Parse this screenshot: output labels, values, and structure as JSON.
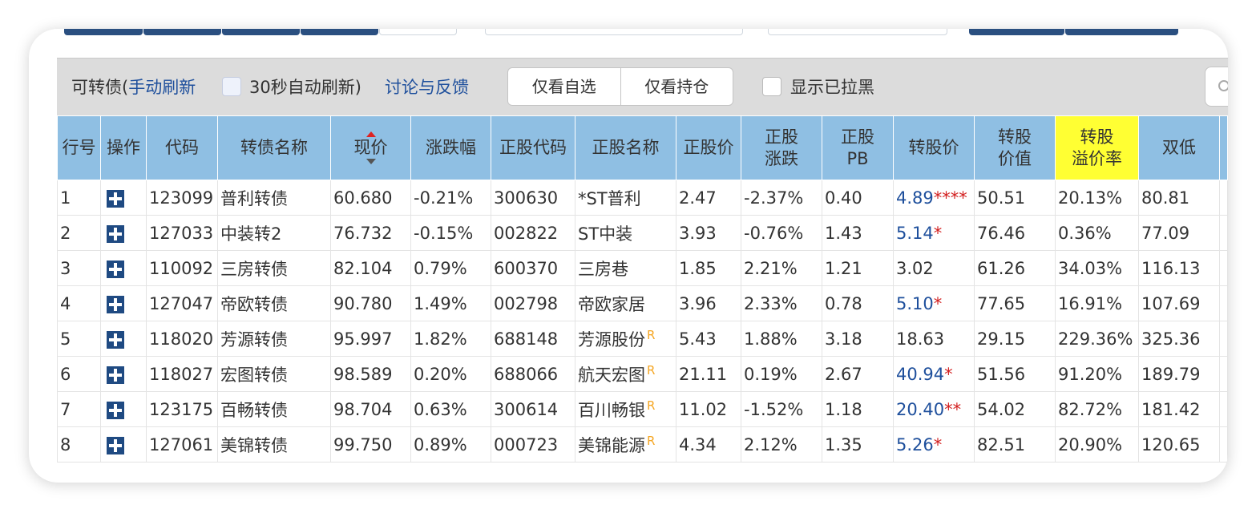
{
  "toolbar": {
    "title_prefix": "可转债(",
    "manual_refresh": "手动刷新",
    "auto_refresh_label": "30秒自动刷新)",
    "feedback": "讨论与反馈",
    "btn_watchlist": "仅看自选",
    "btn_holdings": "仅看持仓",
    "show_blacklist": "显示已拉黑"
  },
  "colors": {
    "header_bg": "#8fbfe3",
    "highlight_header": "#ffff33",
    "link": "#1e4f9c",
    "rise": "#cc2020",
    "fall": "#2a8a1f",
    "r_mark": "#f5a623",
    "star": "#d21e1e",
    "tab_strip": "#2a4f80"
  },
  "columns": {
    "c0": "行号",
    "c1": "操作",
    "c2": "代码",
    "c3": "转债名称",
    "c4": "现价",
    "c5": "涨跌幅",
    "c6": "正股代码",
    "c7": "正股名称",
    "c8": "正股价",
    "c9a": "正股",
    "c9b": "涨跌",
    "c10a": "正股",
    "c10b": "PB",
    "c11": "转股价",
    "c12a": "转股",
    "c12b": "价值",
    "c13a": "转股",
    "c13b": "溢价率",
    "c14": "双低"
  },
  "rows": [
    {
      "no": "1",
      "code": "123099",
      "name": "普利转债",
      "price": "60.680",
      "chg": "-0.21%",
      "scode": "300630",
      "sname": "*ST普利",
      "r": "",
      "sprice": "2.47",
      "schg": "-2.37%",
      "pb": "0.40",
      "cprice": "4.89",
      "stars": "****",
      "cvalue": "50.51",
      "premium": "20.13%",
      "dlow": "80.81"
    },
    {
      "no": "2",
      "code": "127033",
      "name": "中装转2",
      "price": "76.732",
      "chg": "-0.15%",
      "scode": "002822",
      "sname": "ST中装",
      "r": "",
      "sprice": "3.93",
      "schg": "-0.76%",
      "pb": "1.43",
      "cprice": "5.14",
      "stars": "*",
      "cvalue": "76.46",
      "premium": "0.36%",
      "dlow": "77.09"
    },
    {
      "no": "3",
      "code": "110092",
      "name": "三房转债",
      "price": "82.104",
      "chg": "0.79%",
      "scode": "600370",
      "sname": "三房巷",
      "r": "",
      "sprice": "1.85",
      "schg": "2.21%",
      "pb": "1.21",
      "cprice": "3.02",
      "stars": "",
      "cvalue": "61.26",
      "premium": "34.03%",
      "dlow": "116.13"
    },
    {
      "no": "4",
      "code": "127047",
      "name": "帝欧转债",
      "price": "90.780",
      "chg": "1.49%",
      "scode": "002798",
      "sname": "帝欧家居",
      "r": "",
      "sprice": "3.96",
      "schg": "2.33%",
      "pb": "0.78",
      "cprice": "5.10",
      "stars": "*",
      "cvalue": "77.65",
      "premium": "16.91%",
      "dlow": "107.69"
    },
    {
      "no": "5",
      "code": "118020",
      "name": "芳源转债",
      "price": "95.997",
      "chg": "1.82%",
      "scode": "688148",
      "sname": "芳源股份",
      "r": "R",
      "sprice": "5.43",
      "schg": "1.88%",
      "pb": "3.18",
      "cprice": "18.63",
      "stars": "",
      "cvalue": "29.15",
      "premium": "229.36%",
      "dlow": "325.36"
    },
    {
      "no": "6",
      "code": "118027",
      "name": "宏图转债",
      "price": "98.589",
      "chg": "0.20%",
      "scode": "688066",
      "sname": "航天宏图",
      "r": "R",
      "sprice": "21.11",
      "schg": "0.19%",
      "pb": "2.67",
      "cprice": "40.94",
      "stars": "*",
      "cvalue": "51.56",
      "premium": "91.20%",
      "dlow": "189.79"
    },
    {
      "no": "7",
      "code": "123175",
      "name": "百畅转债",
      "price": "98.704",
      "chg": "0.63%",
      "scode": "300614",
      "sname": "百川畅银",
      "r": "R",
      "sprice": "11.02",
      "schg": "-1.52%",
      "pb": "1.18",
      "cprice": "20.40",
      "stars": "**",
      "cvalue": "54.02",
      "premium": "82.72%",
      "dlow": "181.42"
    },
    {
      "no": "8",
      "code": "127061",
      "name": "美锦转债",
      "price": "99.750",
      "chg": "0.89%",
      "scode": "000723",
      "sname": "美锦能源",
      "r": "R",
      "sprice": "4.34",
      "schg": "2.12%",
      "pb": "1.35",
      "cprice": "5.26",
      "stars": "*",
      "cvalue": "82.51",
      "premium": "20.90%",
      "dlow": "120.65"
    }
  ]
}
